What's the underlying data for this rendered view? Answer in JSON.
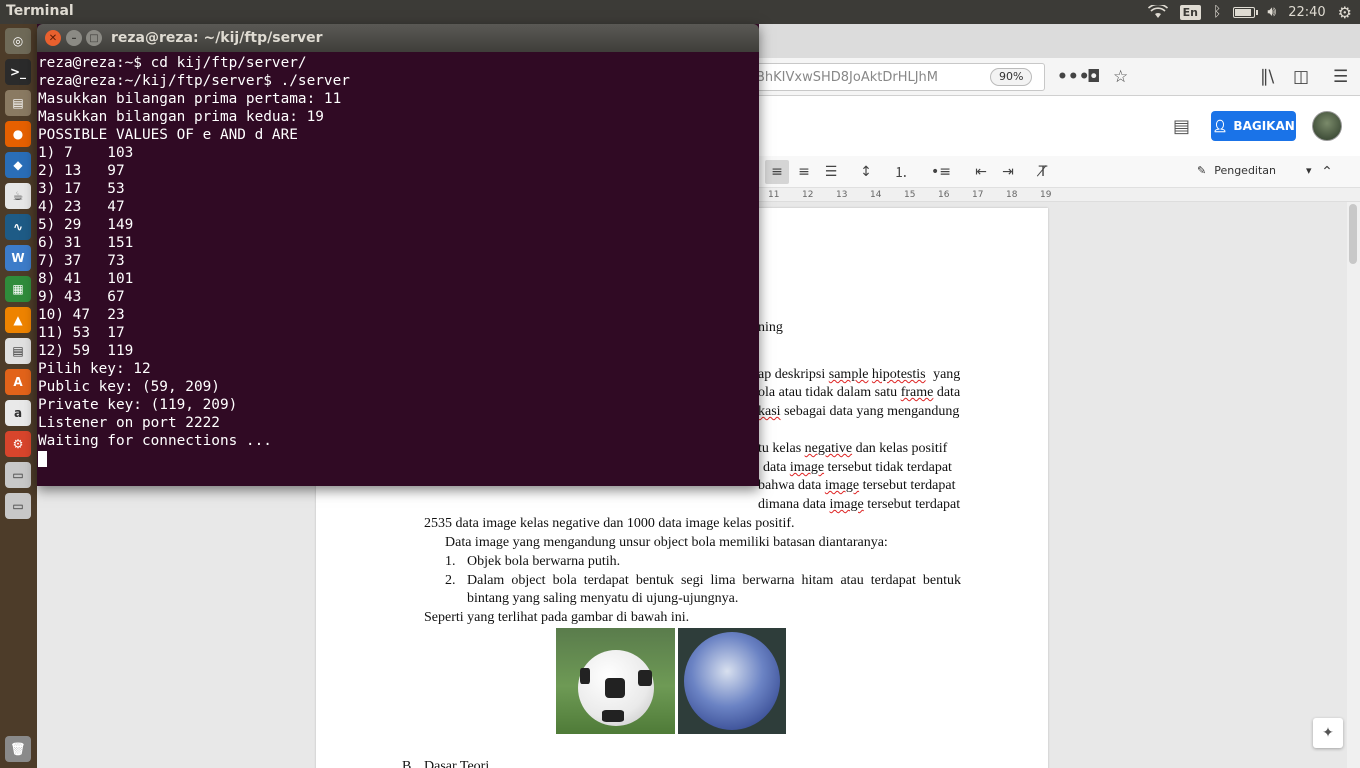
{
  "top_panel": {
    "app_title": "Terminal",
    "language": "En",
    "time": "22:40",
    "battery_level": 0.85,
    "icons": [
      "wifi-icon",
      "bluetooth-icon",
      "battery-icon",
      "volume-icon",
      "settings-icon"
    ]
  },
  "launcher": {
    "items": [
      {
        "name": "dash",
        "glyph": "◎",
        "color": "#6f6a58"
      },
      {
        "name": "terminal",
        "glyph": ">_",
        "color": "#2b2b2b"
      },
      {
        "name": "files",
        "glyph": "▤",
        "color": "#8a7a62"
      },
      {
        "name": "firefox",
        "glyph": "●",
        "color": "#e66000"
      },
      {
        "name": "vscode",
        "glyph": "◆",
        "color": "#2a6eb8"
      },
      {
        "name": "java",
        "glyph": "☕",
        "color": "#e7e7e7"
      },
      {
        "name": "monitor",
        "glyph": "∿",
        "color": "#1e5b86"
      },
      {
        "name": "writer",
        "glyph": "W",
        "color": "#3d7cc9"
      },
      {
        "name": "calc",
        "glyph": "▦",
        "color": "#2f8c3b"
      },
      {
        "name": "vlc",
        "glyph": "▲",
        "color": "#ee8300"
      },
      {
        "name": "document",
        "glyph": "▤",
        "color": "#e0e0e0"
      },
      {
        "name": "software",
        "glyph": "A",
        "color": "#e2631a"
      },
      {
        "name": "amazon",
        "glyph": "a",
        "color": "#e9e9e9"
      },
      {
        "name": "system-settings",
        "glyph": "⚙",
        "color": "#d8452c"
      },
      {
        "name": "drive1",
        "glyph": "▭",
        "color": "#c8c8c8"
      },
      {
        "name": "drive2",
        "glyph": "▭",
        "color": "#c8c8c8"
      },
      {
        "name": "trash",
        "glyph": "🗑",
        "color": "#8a8a8a"
      }
    ]
  },
  "terminal": {
    "title": "reza@reza: ~/kij/ftp/server",
    "lines": [
      "reza@reza:~$ cd kij/ftp/server/",
      "reza@reza:~/kij/ftp/server$ ./server",
      "Masukkan bilangan prima pertama: 11",
      "Masukkan bilangan prima kedua: 19",
      "POSSIBLE VALUES OF e AND d ARE",
      "1) 7    103",
      "2) 13   97",
      "3) 17   53",
      "4) 23   47",
      "5) 29   149",
      "6) 31   151",
      "7) 37   73",
      "8) 41   101",
      "9) 43   67",
      "10) 47  23",
      "11) 53  17",
      "12) 59  119",
      "Pilih key: 12",
      "Public key: (59, 209)",
      "Private key: (119, 209)",
      "Listener on port 2222",
      "Waiting for connections ..."
    ]
  },
  "browser": {
    "url_fragment": "BhKIVxwSHD8JoAktDrHLJhM",
    "zoom": "90%",
    "share_label": "BAGIKAN",
    "edit_mode_label": "Pengeditan",
    "ruler_numbers": [
      "11",
      "12",
      "13",
      "14",
      "15",
      "16",
      "17",
      "18",
      "19"
    ]
  },
  "document": {
    "frag_1": "ning",
    "frag_2a": "ap deskripsi",
    "frag_2b": "sample",
    "frag_2c": "hipotestis",
    "frag_2d": "yang",
    "frag_3a": "ola atau tidak dalam satu",
    "frag_3b": "frame",
    "frag_3c": "data",
    "frag_4a": "kasi",
    "frag_4b": "sebagai data yang mengandung",
    "frag_5a": "tu kelas",
    "frag_5b": "negative",
    "frag_5c": "dan kelas positif",
    "frag_6a": "data",
    "frag_6b": "image",
    "frag_6c": "tersebut tidak terdapat",
    "frag_7a": "bahwa data",
    "frag_7b": "image",
    "frag_7c": "tersebut terdapat",
    "frag_8a": "dimana data",
    "frag_8b": "image",
    "frag_8c": "tersebut terdapat",
    "line_9": "2535 data image kelas negative dan 1000 data image kelas positif.",
    "line_10": "Data image yang mengandung unsur object bola memiliki batasan diantaranya:",
    "list_1_num": "1.",
    "list_1": "Objek bola berwarna putih.",
    "list_2_num": "2.",
    "list_2a": "Dalam object bola terdapat bentuk segi lima berwarna hitam atau terdapat bentuk",
    "list_2b": "bintang yang saling menyatu di ujung-ujungnya.",
    "line_11": "Seperti yang terlihat pada gambar di bawah ini.",
    "heading_b_letter": "B.",
    "heading_b": "Dasar Teori"
  }
}
